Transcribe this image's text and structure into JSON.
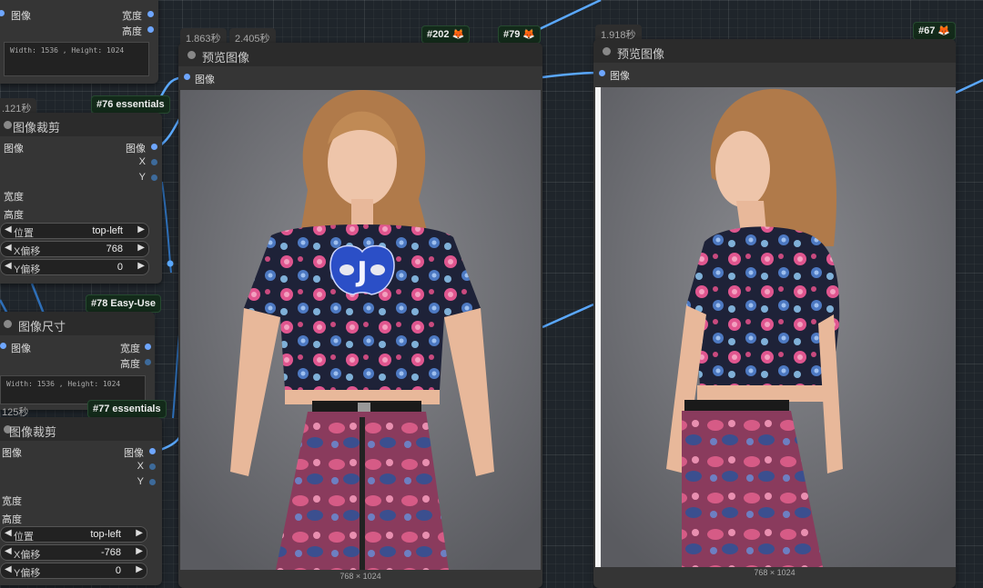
{
  "timings": {
    "t_top_left": "1.863秒",
    "t_top_mid": "2.405秒",
    "t_top_right": "1.918秒",
    "t_left_a": ".121秒",
    "t_left_b": "125秒"
  },
  "badges": {
    "b202": "#202 🦊",
    "b79": "#79 🦊",
    "b67": "#67 🦊",
    "b76": "#76 essentials",
    "b78": "#78 Easy-Use",
    "b77": "#77 essentials"
  },
  "node_top_size": {
    "in_image": "图像",
    "out_width": "宽度",
    "out_height": "高度",
    "info": "Width: 1536 , Height: 1024"
  },
  "node_crop_1": {
    "title": "图像裁剪",
    "in_image": "图像",
    "out_image": "图像",
    "out_x": "X",
    "out_y": "Y",
    "in_width": "宽度",
    "in_height": "高度",
    "pos_name": "位置",
    "pos_val": "top-left",
    "xoff_name": "X偏移",
    "xoff_val": "768",
    "yoff_name": "Y偏移",
    "yoff_val": "0"
  },
  "node_size_2": {
    "title": "图像尺寸",
    "in_image": "图像",
    "out_width": "宽度",
    "out_height": "高度",
    "info": "Width: 1536 , Height: 1024"
  },
  "node_crop_2": {
    "title": "图像裁剪",
    "in_image": "图像",
    "out_image": "图像",
    "out_x": "X",
    "out_y": "Y",
    "in_width": "宽度",
    "in_height": "高度",
    "pos_name": "位置",
    "pos_val": "top-left",
    "xoff_name": "X偏移",
    "xoff_val": "-768",
    "yoff_name": "Y偏移",
    "yoff_val": "0"
  },
  "preview_1": {
    "title": "预览图像",
    "in_image": "图像",
    "dims": "768 × 1024",
    "mask_letter": "J"
  },
  "preview_2": {
    "title": "预览图像",
    "in_image": "图像",
    "dims": "768 × 1024"
  },
  "colors": {
    "link": "#5aa8ff",
    "canvas": "#1f252b",
    "node": "#353535",
    "badge_bg": "#132a1a"
  }
}
